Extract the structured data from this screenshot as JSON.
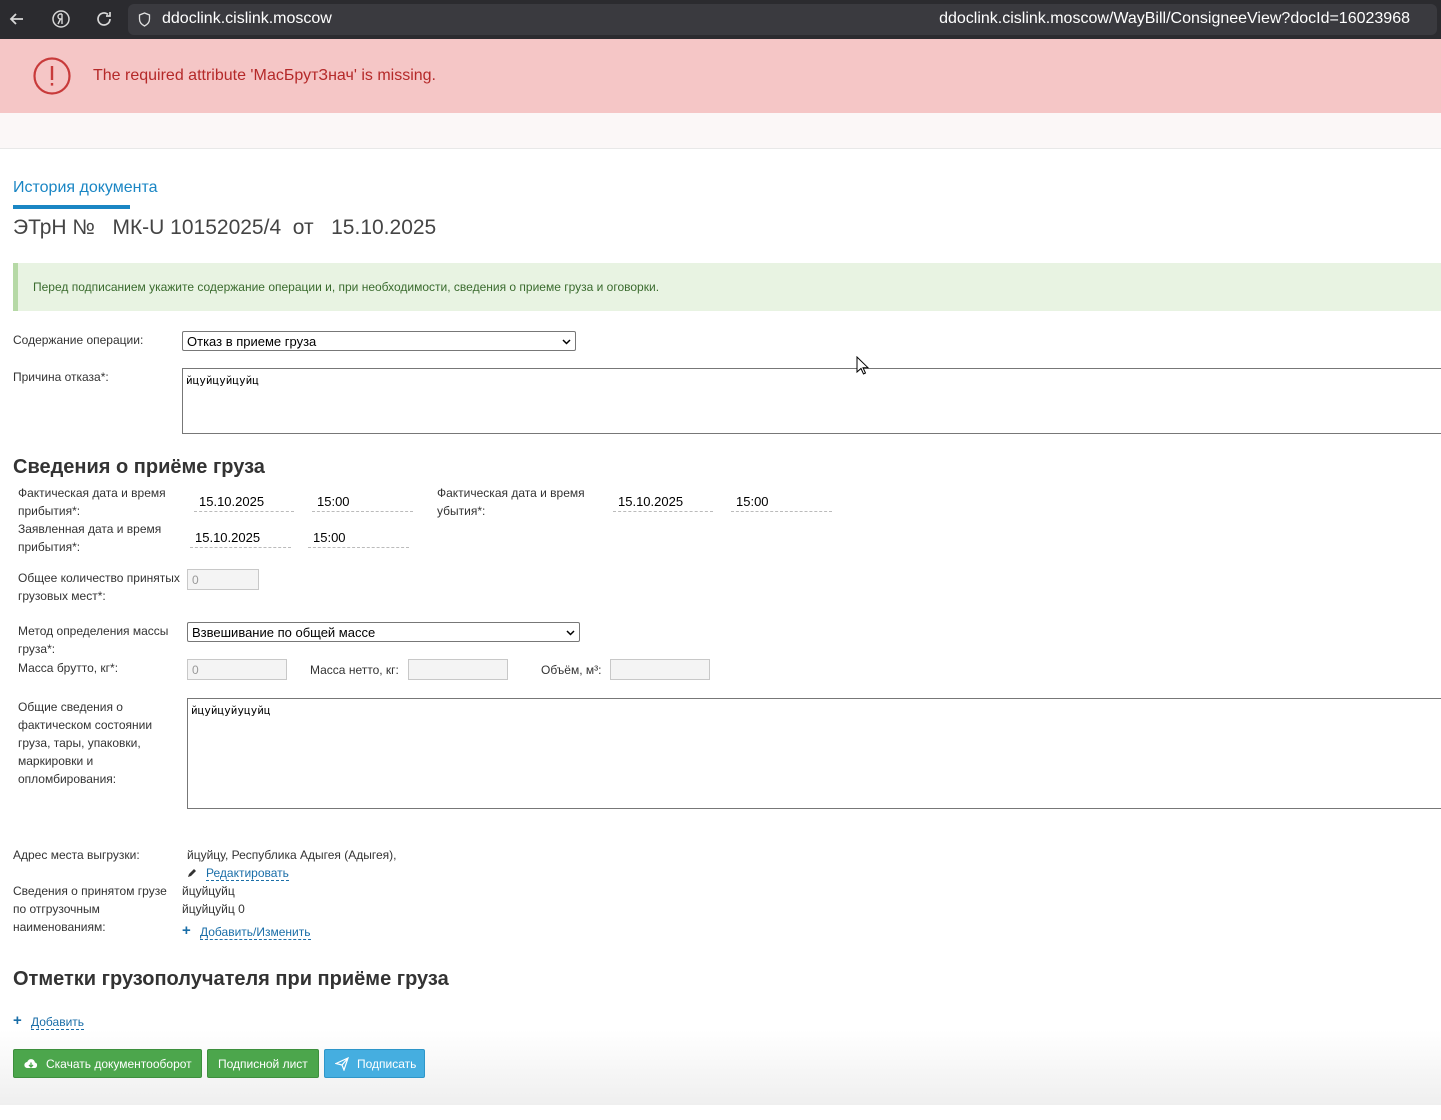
{
  "browser": {
    "host": "ddoclink.cislink.moscow",
    "url": "ddoclink.cislink.moscow/WayBill/ConsigneeView?docId=16023968",
    "icons": [
      "back-icon",
      "yandex-icon",
      "reload-icon",
      "shield-icon"
    ]
  },
  "error": {
    "message": "The required attribute 'МасБрутЗнач' is missing."
  },
  "tab": {
    "history": "История документа"
  },
  "doc": {
    "title": "ЭТрН №   МК-U 10152025/4  от   15.10.2025"
  },
  "info": {
    "message": "Перед подписанием укажите содержание операции и, при необходимости, сведения о приеме груза и оговорки."
  },
  "operation": {
    "label": "Содержание операции:",
    "value": "Отказ в приеме груза",
    "reason_label": "Причина отказа*:",
    "reason_value": "йцуйцуйцуйц"
  },
  "cargo": {
    "heading": "Сведения о приёме груза",
    "actual_arrival_label": "Фактическая дата и время прибытия*:",
    "actual_arrival_date": "15.10.2025",
    "actual_arrival_time": "15:00",
    "actual_departure_label": "Фактическая дата и время убытия*:",
    "actual_departure_date": "15.10.2025",
    "actual_departure_time": "15:00",
    "declared_arrival_label": "Заявленная дата и время прибытия*:",
    "declared_arrival_date": "15.10.2025",
    "declared_arrival_time": "15:00",
    "places_label": "Общее количество принятых грузовых мест*:",
    "places_value": "0",
    "mass_method_label": "Метод определения массы груза*:",
    "mass_method_value": "Взвешивание по общей массе",
    "gross_label": "Масса брутто, кг*:",
    "gross_value": "0",
    "net_label": "Масса нетто, кг:",
    "net_value": "",
    "volume_label": "Объём, м³:",
    "volume_value": "",
    "condition_label": "Общие сведения о фактическом состоянии груза, тары, упаковки, маркировки и опломбирования:",
    "condition_value": "йцуйцуйуцуйц",
    "address_label": "Адрес места выгрузки:",
    "address_value": "йцуйцу, Республика Адыгея (Адыгея),",
    "edit_link": "Редактировать",
    "accepted_label": "Сведения о принятом грузе по отгрузочным наименованиям:",
    "accepted_line1": "йцуйцуйц",
    "accepted_line2": "йцуйцуйц 0",
    "add_change_link": "Добавить/Изменить"
  },
  "marks": {
    "heading": "Отметки грузополучателя при приёме груза",
    "add_link": "Добавить"
  },
  "buttons": {
    "download": "Скачать документооборот",
    "sign_sheet": "Подписной лист",
    "sign": "Подписать"
  },
  "colors": {
    "accent": "#1a86c4",
    "error_bg": "#f5c6c6",
    "error_text": "#b52929",
    "green": "#4ca64c",
    "blue": "#45aee0"
  }
}
